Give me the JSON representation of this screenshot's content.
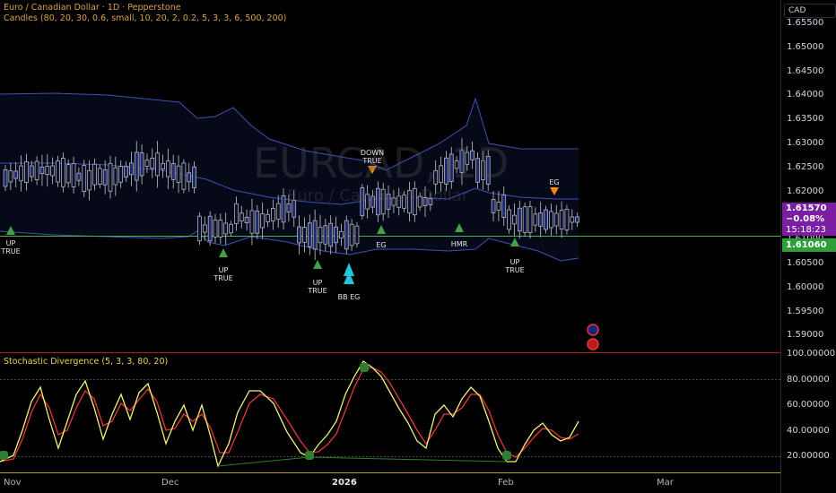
{
  "header": {
    "title": "Euro / Canadian Dollar · 1D · Pepperstone",
    "indicator": "Candles (80, 20, 30, 0.6, small, 10, 20, 2, 0.2, 5, 3, 3, 6, 500, 200)",
    "stochastic": "Stochastic Divergence (5, 3, 3, 80, 20)"
  },
  "watermark": {
    "symbol": "EURCAD, 1D",
    "name": "Euro / Canadian Dollar"
  },
  "currency_button": "CAD",
  "price_axis": [
    "1.65500",
    "1.65000",
    "1.64500",
    "1.64000",
    "1.63500",
    "1.63000",
    "1.62500",
    "1.62000",
    "1.61500",
    "1.61000",
    "1.60500",
    "1.60000",
    "1.59500",
    "1.59000"
  ],
  "stoch_axis": [
    "100.00000",
    "80.00000",
    "60.00000",
    "40.00000",
    "20.00000"
  ],
  "time_axis": [
    {
      "label": "Nov",
      "bold": false
    },
    {
      "label": "Dec",
      "bold": false
    },
    {
      "label": "2026",
      "bold": true
    },
    {
      "label": "Feb",
      "bold": false
    },
    {
      "label": "Mar",
      "bold": false
    }
  ],
  "last_price": {
    "price": "1.61570",
    "change": "−0.08%",
    "countdown": "15:18:23"
  },
  "level_line": {
    "price": "1.61060"
  },
  "signals": [
    {
      "text": [
        "UP",
        "TRUE"
      ]
    },
    {
      "text": [
        "UP",
        "TRUE"
      ]
    },
    {
      "text": [
        "UP",
        "TRUE"
      ]
    },
    {
      "text": [
        "BB EG"
      ]
    },
    {
      "text": [
        "DOWN",
        "TRUE"
      ]
    },
    {
      "text": [
        "EG"
      ]
    },
    {
      "text": [
        "HMR"
      ]
    },
    {
      "text": [
        "UP",
        "TRUE"
      ]
    },
    {
      "text": [
        "EG"
      ]
    }
  ],
  "colors": {
    "bull": "#1e2a6e",
    "bear": "#0c1030",
    "wick": "#c8c8c8",
    "band": "#3f51b5",
    "k_line": "#f5f07a",
    "d_line": "#e53935",
    "level": "#4caf50",
    "divider": "#b71c1c",
    "up_arrow": "#43a047",
    "down_arrow": "#fb8c00",
    "bb_arrow": "#26c6da"
  }
}
